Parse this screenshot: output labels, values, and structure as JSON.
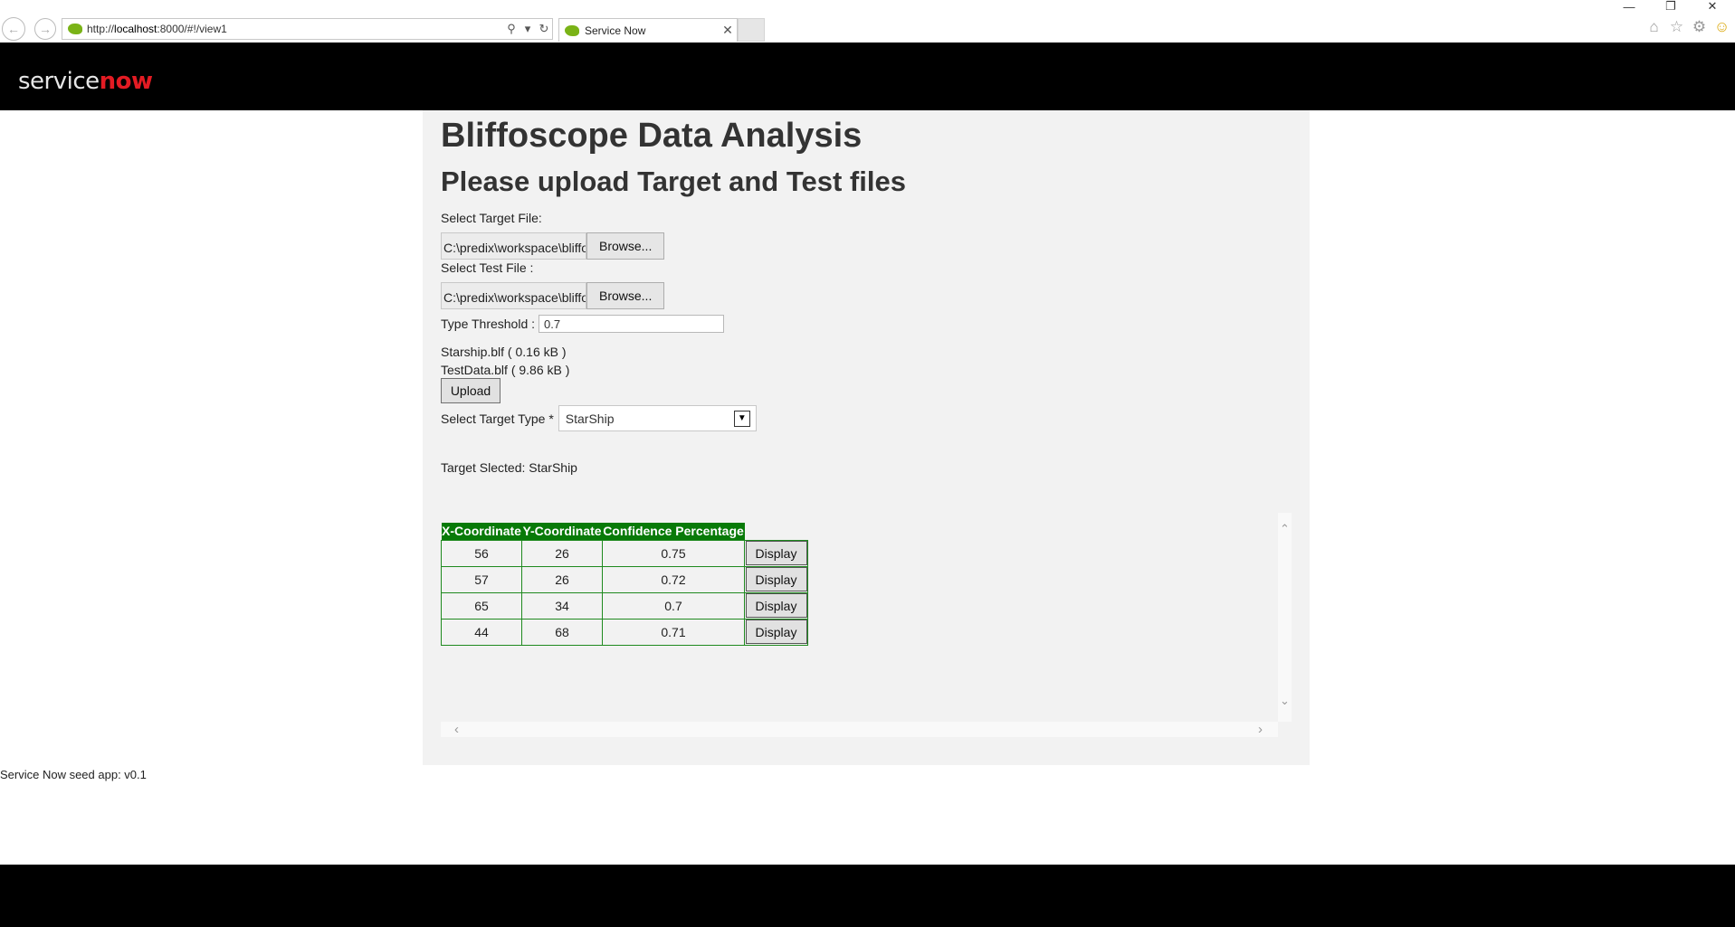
{
  "browser": {
    "url_prefix": "http://",
    "url_host": "localhost",
    "url_rest": ":8000/#!/view1",
    "tab_title": "Service Now"
  },
  "header": {
    "logo_part1": "service",
    "logo_part2": "now"
  },
  "main": {
    "title": "Bliffoscope Data Analysis",
    "subtitle": "Please upload Target and Test files",
    "target_file_label": "Select Target File:",
    "target_file_value": "C:\\predix\\workspace\\bliffoscope\\Starship.blf",
    "test_file_label": "Select Test File :",
    "test_file_value": "C:\\predix\\workspace\\bliffoscope\\TestData.blf",
    "browse_label": "Browse...",
    "threshold_label": "Type Threshold :",
    "threshold_value": "0.7",
    "uploaded_files": [
      "Starship.blf ( 0.16 kB )",
      "TestData.blf ( 9.86 kB )"
    ],
    "upload_label": "Upload",
    "target_type_label": "Select Target Type *",
    "target_type_value": "StarShip",
    "target_selected_text": "Target Slected: StarShip"
  },
  "results": {
    "headers": [
      "X-Coordinate",
      "Y-Coordinate",
      "Confidence Percentage"
    ],
    "display_label": "Display",
    "rows": [
      [
        "56",
        "26",
        "0.75"
      ],
      [
        "57",
        "26",
        "0.72"
      ],
      [
        "65",
        "34",
        "0.7"
      ],
      [
        "44",
        "68",
        "0.71"
      ]
    ]
  },
  "footer": {
    "version_text": "Service Now seed app: v0.1"
  },
  "colors": {
    "header_bg": "#000000",
    "logo_accent": "#e31b23",
    "table_header_bg": "#087a08",
    "panel_bg": "#f2f2f2"
  }
}
